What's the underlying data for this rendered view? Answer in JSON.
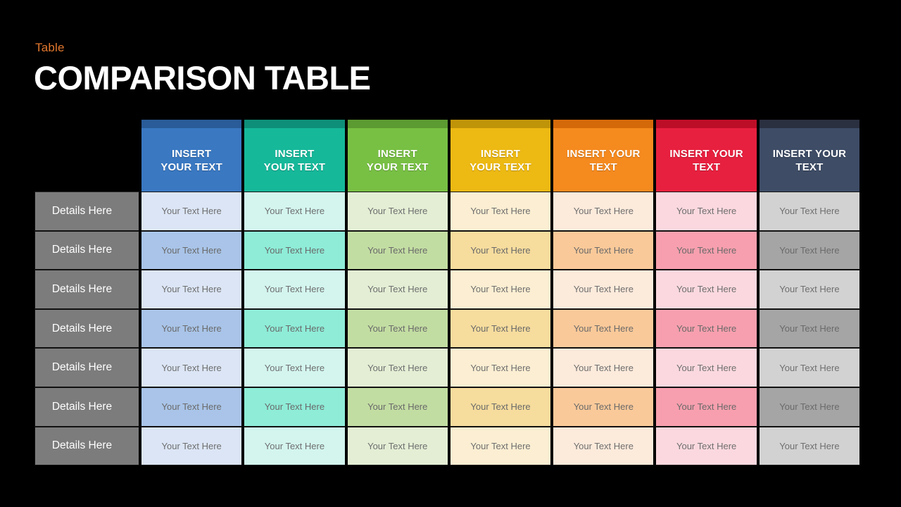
{
  "slide": {
    "background": "#000000",
    "eyebrow": "Table",
    "title": "COMPARISON TABLE",
    "eyebrow_color": "#e2772e",
    "title_color": "#ffffff"
  },
  "table": {
    "label_column": {
      "header": "",
      "background": "#7c7c7c",
      "text_color": "#ffffff",
      "rows": [
        "Details Here",
        "Details Here",
        "Details Here",
        "Details Here",
        "Details Here",
        "Details Here",
        "Details Here"
      ]
    },
    "cell_text": "Your Text Here",
    "cell_text_color": "#6f6f6f",
    "columns": [
      {
        "header": "INSERT YOUR TEXT",
        "header_line1": "INSERT",
        "header_line2": "YOUR TEXT",
        "header_color": "#3a78c2",
        "cap_color": "#2a5c99",
        "row_light": "#dbe5f5",
        "row_dark": "#a9c4e8"
      },
      {
        "header": "INSERT YOUR TEXT",
        "header_line1": "INSERT",
        "header_line2": "YOUR TEXT",
        "header_color": "#16b89a",
        "cap_color": "#0e8f79",
        "row_light": "#d3f5ee",
        "row_dark": "#8eecd7"
      },
      {
        "header": "INSERT YOUR TEXT",
        "header_line1": "INSERT",
        "header_line2": "YOUR TEXT",
        "header_color": "#78c044",
        "cap_color": "#5c9a32",
        "row_light": "#e3eed4",
        "row_dark": "#c2dda2"
      },
      {
        "header": "INSERT YOUR TEXT",
        "header_line1": "INSERT",
        "header_line2": "YOUR TEXT",
        "header_color": "#edb913",
        "cap_color": "#c09409",
        "row_light": "#fbeed2",
        "row_dark": "#f6dc9d"
      },
      {
        "header": "INSERT YOUR TEXT",
        "header_line1": "INSERT YOUR",
        "header_line2": "TEXT",
        "header_color": "#f58a1f",
        "cap_color": "#d4690a",
        "row_light": "#fceadb",
        "row_dark": "#fac999"
      },
      {
        "header": "INSERT YOUR TEXT",
        "header_line1": "INSERT YOUR",
        "header_line2": "TEXT",
        "header_color": "#e8203f",
        "cap_color": "#bd0e28",
        "row_light": "#fbd8df",
        "row_dark": "#f79fae"
      },
      {
        "header": "INSERT YOUR TEXT",
        "header_line1": "INSERT YOUR",
        "header_line2": "TEXT",
        "header_color": "#3e4c66",
        "cap_color": "#2a3040",
        "row_light": "#d2d2d2",
        "row_dark": "#a5a5a5"
      }
    ],
    "row_count": 7,
    "column_count": 7
  }
}
